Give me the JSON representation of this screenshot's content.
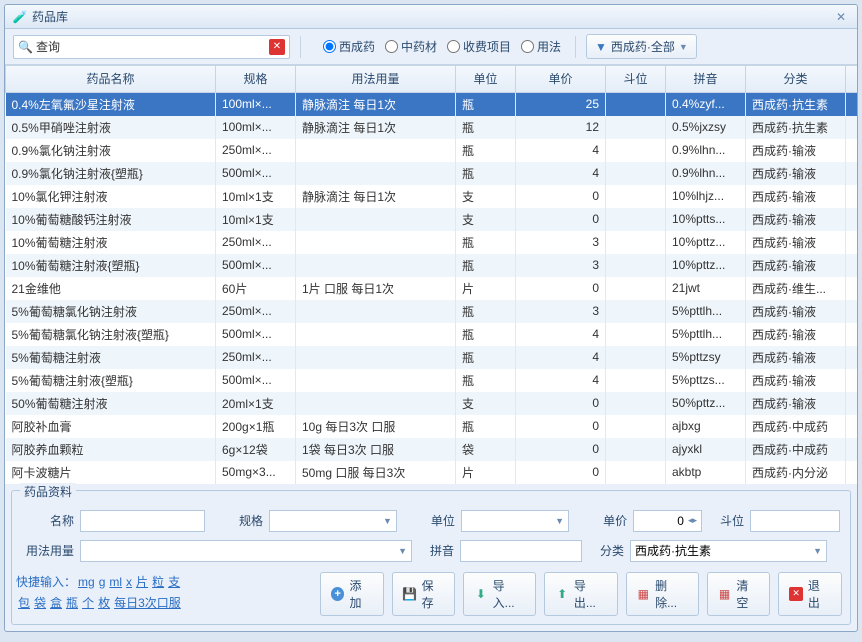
{
  "window": {
    "title": "药品库"
  },
  "toolbar": {
    "search_label": "查询",
    "search_value": "",
    "radios": [
      "西成药",
      "中药材",
      "收费项目",
      "用法"
    ],
    "radio_selected": 0,
    "filter_label": "西成药·全部"
  },
  "columns": [
    "药品名称",
    "规格",
    "用法用量",
    "单位",
    "单价",
    "斗位",
    "拼音",
    "分类"
  ],
  "rows": [
    {
      "name": "0.4%左氧氟沙星注射液",
      "spec": "100ml×...",
      "usage": "静脉滴注 每日1次",
      "unit": "瓶",
      "price": "25",
      "dou": "",
      "py": "0.4%zyf...",
      "cat": "西成药·抗生素",
      "sel": true
    },
    {
      "name": "0.5%甲硝唑注射液",
      "spec": "100ml×...",
      "usage": "静脉滴注 每日1次",
      "unit": "瓶",
      "price": "12",
      "dou": "",
      "py": "0.5%jxzsy",
      "cat": "西成药·抗生素"
    },
    {
      "name": "0.9%氯化钠注射液",
      "spec": "250ml×...",
      "usage": "",
      "unit": "瓶",
      "price": "4",
      "dou": "",
      "py": "0.9%lhn...",
      "cat": "西成药·输液"
    },
    {
      "name": "0.9%氯化钠注射液{塑瓶}",
      "spec": "500ml×...",
      "usage": "",
      "unit": "瓶",
      "price": "4",
      "dou": "",
      "py": "0.9%lhn...",
      "cat": "西成药·输液"
    },
    {
      "name": "10%氯化钾注射液",
      "spec": "10ml×1支",
      "usage": "静脉滴注 每日1次",
      "unit": "支",
      "price": "0",
      "dou": "",
      "py": "10%lhjz...",
      "cat": "西成药·输液"
    },
    {
      "name": "10%葡萄糖酸钙注射液",
      "spec": "10ml×1支",
      "usage": "",
      "unit": "支",
      "price": "0",
      "dou": "",
      "py": "10%ptts...",
      "cat": "西成药·输液"
    },
    {
      "name": "10%葡萄糖注射液",
      "spec": "250ml×...",
      "usage": "",
      "unit": "瓶",
      "price": "3",
      "dou": "",
      "py": "10%pttz...",
      "cat": "西成药·输液"
    },
    {
      "name": "10%葡萄糖注射液{塑瓶}",
      "spec": "500ml×...",
      "usage": "",
      "unit": "瓶",
      "price": "3",
      "dou": "",
      "py": "10%pttz...",
      "cat": "西成药·输液"
    },
    {
      "name": "21金维他",
      "spec": "60片",
      "usage": "1片 口服 每日1次",
      "unit": "片",
      "price": "0",
      "dou": "",
      "py": "21jwt",
      "cat": "西成药·维生..."
    },
    {
      "name": "5%葡萄糖氯化钠注射液",
      "spec": "250ml×...",
      "usage": "",
      "unit": "瓶",
      "price": "3",
      "dou": "",
      "py": "5%pttlh...",
      "cat": "西成药·输液"
    },
    {
      "name": "5%葡萄糖氯化钠注射液{塑瓶}",
      "spec": "500ml×...",
      "usage": "",
      "unit": "瓶",
      "price": "4",
      "dou": "",
      "py": "5%pttlh...",
      "cat": "西成药·输液"
    },
    {
      "name": "5%葡萄糖注射液",
      "spec": "250ml×...",
      "usage": "",
      "unit": "瓶",
      "price": "4",
      "dou": "",
      "py": "5%pttzsy",
      "cat": "西成药·输液"
    },
    {
      "name": "5%葡萄糖注射液{塑瓶}",
      "spec": "500ml×...",
      "usage": "",
      "unit": "瓶",
      "price": "4",
      "dou": "",
      "py": "5%pttzs...",
      "cat": "西成药·输液"
    },
    {
      "name": "50%葡萄糖注射液",
      "spec": "20ml×1支",
      "usage": "",
      "unit": "支",
      "price": "0",
      "dou": "",
      "py": "50%pttz...",
      "cat": "西成药·输液"
    },
    {
      "name": "阿胶补血膏",
      "spec": "200g×1瓶",
      "usage": "10g 每日3次 口服",
      "unit": "瓶",
      "price": "0",
      "dou": "",
      "py": "ajbxg",
      "cat": "西成药·中成药"
    },
    {
      "name": "阿胶养血颗粒",
      "spec": "6g×12袋",
      "usage": "1袋 每日3次 口服",
      "unit": "袋",
      "price": "0",
      "dou": "",
      "py": "ajyxkl",
      "cat": "西成药·中成药"
    },
    {
      "name": "阿卡波糖片",
      "spec": "50mg×3...",
      "usage": "50mg 口服 每日3次",
      "unit": "片",
      "price": "0",
      "dou": "",
      "py": "akbtp",
      "cat": "西成药·内分泌"
    }
  ],
  "form": {
    "group_title": "药品资料",
    "labels": {
      "name": "名称",
      "spec": "规格",
      "unit": "单位",
      "price": "单价",
      "dou": "斗位",
      "usage": "用法用量",
      "py": "拼音",
      "cat": "分类"
    },
    "values": {
      "name": "",
      "spec": "",
      "unit": "",
      "price": "0",
      "dou": "",
      "usage": "",
      "py": "",
      "cat": "西成药·抗生素"
    },
    "quick_label": "快捷输入：",
    "quick_links": [
      "mg",
      "g",
      "ml",
      "x",
      "片",
      "粒",
      "支",
      "包",
      "袋",
      "盒",
      "瓶",
      "个",
      "枚",
      "每日3次口服"
    ]
  },
  "buttons": {
    "add": "添加",
    "save": "保存",
    "import": "导入...",
    "export": "导出...",
    "delete": "删除...",
    "clear": "清空",
    "exit": "退出"
  }
}
